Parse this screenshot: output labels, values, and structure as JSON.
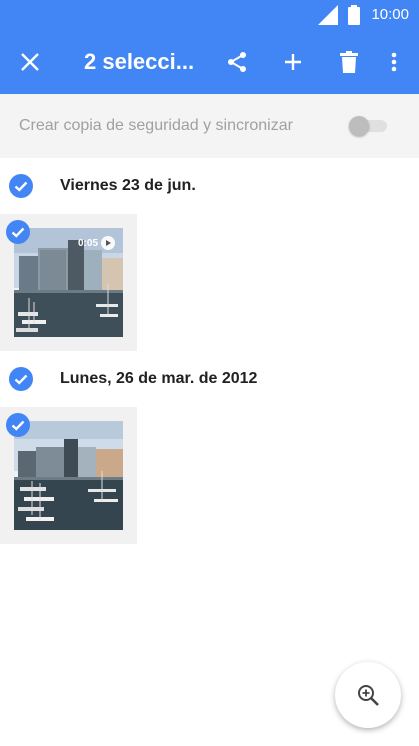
{
  "status_bar": {
    "time": "10:00"
  },
  "app_bar": {
    "title": "2 selecci...",
    "close_icon": "close-icon",
    "share_icon": "share-icon",
    "add_icon": "add-icon",
    "delete_icon": "delete-icon",
    "more_icon": "more-vert-icon"
  },
  "backup": {
    "label": "Crear copia de seguridad y sincronizar",
    "enabled": false
  },
  "groups": [
    {
      "date": "Viernes 23 de jun.",
      "items": [
        {
          "type": "video",
          "duration": "0:05",
          "selected": true
        }
      ],
      "selected": true
    },
    {
      "date": "Lunes, 26 de mar. de 2012",
      "items": [
        {
          "type": "photo",
          "selected": true
        }
      ],
      "selected": true
    }
  ],
  "fab": {
    "icon": "zoom-in-icon"
  },
  "colors": {
    "primary": "#4285f4",
    "check": "#4285f4"
  }
}
